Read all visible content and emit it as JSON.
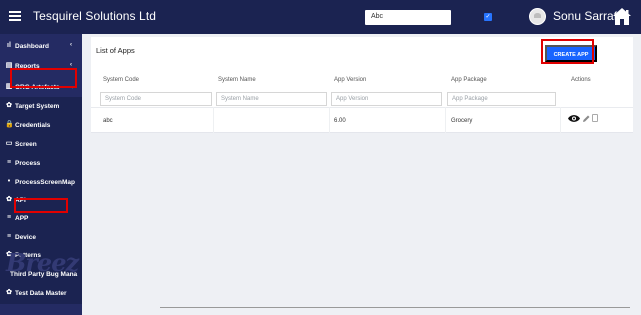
{
  "header": {
    "title": "Tesquirel Solutions Ltd",
    "search_value": "Abc",
    "user_name": "Sonu Sarraf",
    "checkbox_checked": true,
    "icons": [
      "menu-icon",
      "avatar",
      "home-icon"
    ],
    "colors": {
      "topbar": "#1b2351",
      "sidebar": "#242b63",
      "accent": "#1964ff",
      "highlight": "#e10000"
    }
  },
  "sidebar": {
    "items": [
      {
        "label": "Dashboard",
        "icon": "bar-chart-icon"
      },
      {
        "label": "Reports",
        "icon": "document-icon"
      },
      {
        "label": "ORG Artefacts",
        "icon": "building-icon"
      },
      {
        "label": "Target System",
        "icon": "gear-icon"
      },
      {
        "label": "Credentials",
        "icon": "lock-icon"
      },
      {
        "label": "Screen",
        "icon": "monitor-icon"
      },
      {
        "label": "Process",
        "icon": "stack-icon"
      },
      {
        "label": "ProcessScreenMap",
        "icon": "dot-icon"
      },
      {
        "label": "API",
        "icon": "gear-icon"
      },
      {
        "label": "APP",
        "icon": "stack-icon"
      },
      {
        "label": "Device",
        "icon": "stack-icon"
      },
      {
        "label": "Patterns",
        "icon": "gear-icon"
      },
      {
        "label": "Third Party Bug Mana",
        "icon": ""
      },
      {
        "label": "Test Data Master",
        "icon": "gear-icon"
      }
    ],
    "logo": "Breez"
  },
  "main": {
    "title": "List of Apps",
    "create_button": "CREATE APP",
    "columns": [
      "System Code",
      "System Name",
      "App Version",
      "App Package",
      "Actions"
    ],
    "filters": [
      "System Code",
      "System Name",
      "App Version",
      "App Package"
    ],
    "rows": [
      {
        "system_code": "abc",
        "system_name": "",
        "app_version": "6.00",
        "app_package": "Grocery"
      }
    ],
    "action_icons": [
      "eye-icon",
      "pencil-icon",
      "trash-icon"
    ]
  }
}
